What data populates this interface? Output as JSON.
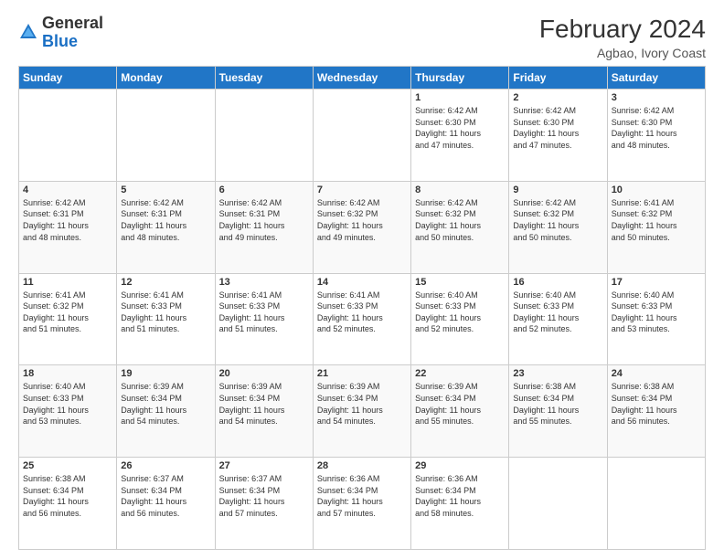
{
  "header": {
    "logo_general": "General",
    "logo_blue": "Blue",
    "month_year": "February 2024",
    "location": "Agbao, Ivory Coast"
  },
  "weekdays": [
    "Sunday",
    "Monday",
    "Tuesday",
    "Wednesday",
    "Thursday",
    "Friday",
    "Saturday"
  ],
  "weeks": [
    [
      {
        "day": "",
        "info": ""
      },
      {
        "day": "",
        "info": ""
      },
      {
        "day": "",
        "info": ""
      },
      {
        "day": "",
        "info": ""
      },
      {
        "day": "1",
        "info": "Sunrise: 6:42 AM\nSunset: 6:30 PM\nDaylight: 11 hours\nand 47 minutes."
      },
      {
        "day": "2",
        "info": "Sunrise: 6:42 AM\nSunset: 6:30 PM\nDaylight: 11 hours\nand 47 minutes."
      },
      {
        "day": "3",
        "info": "Sunrise: 6:42 AM\nSunset: 6:30 PM\nDaylight: 11 hours\nand 48 minutes."
      }
    ],
    [
      {
        "day": "4",
        "info": "Sunrise: 6:42 AM\nSunset: 6:31 PM\nDaylight: 11 hours\nand 48 minutes."
      },
      {
        "day": "5",
        "info": "Sunrise: 6:42 AM\nSunset: 6:31 PM\nDaylight: 11 hours\nand 48 minutes."
      },
      {
        "day": "6",
        "info": "Sunrise: 6:42 AM\nSunset: 6:31 PM\nDaylight: 11 hours\nand 49 minutes."
      },
      {
        "day": "7",
        "info": "Sunrise: 6:42 AM\nSunset: 6:32 PM\nDaylight: 11 hours\nand 49 minutes."
      },
      {
        "day": "8",
        "info": "Sunrise: 6:42 AM\nSunset: 6:32 PM\nDaylight: 11 hours\nand 50 minutes."
      },
      {
        "day": "9",
        "info": "Sunrise: 6:42 AM\nSunset: 6:32 PM\nDaylight: 11 hours\nand 50 minutes."
      },
      {
        "day": "10",
        "info": "Sunrise: 6:41 AM\nSunset: 6:32 PM\nDaylight: 11 hours\nand 50 minutes."
      }
    ],
    [
      {
        "day": "11",
        "info": "Sunrise: 6:41 AM\nSunset: 6:32 PM\nDaylight: 11 hours\nand 51 minutes."
      },
      {
        "day": "12",
        "info": "Sunrise: 6:41 AM\nSunset: 6:33 PM\nDaylight: 11 hours\nand 51 minutes."
      },
      {
        "day": "13",
        "info": "Sunrise: 6:41 AM\nSunset: 6:33 PM\nDaylight: 11 hours\nand 51 minutes."
      },
      {
        "day": "14",
        "info": "Sunrise: 6:41 AM\nSunset: 6:33 PM\nDaylight: 11 hours\nand 52 minutes."
      },
      {
        "day": "15",
        "info": "Sunrise: 6:40 AM\nSunset: 6:33 PM\nDaylight: 11 hours\nand 52 minutes."
      },
      {
        "day": "16",
        "info": "Sunrise: 6:40 AM\nSunset: 6:33 PM\nDaylight: 11 hours\nand 52 minutes."
      },
      {
        "day": "17",
        "info": "Sunrise: 6:40 AM\nSunset: 6:33 PM\nDaylight: 11 hours\nand 53 minutes."
      }
    ],
    [
      {
        "day": "18",
        "info": "Sunrise: 6:40 AM\nSunset: 6:33 PM\nDaylight: 11 hours\nand 53 minutes."
      },
      {
        "day": "19",
        "info": "Sunrise: 6:39 AM\nSunset: 6:34 PM\nDaylight: 11 hours\nand 54 minutes."
      },
      {
        "day": "20",
        "info": "Sunrise: 6:39 AM\nSunset: 6:34 PM\nDaylight: 11 hours\nand 54 minutes."
      },
      {
        "day": "21",
        "info": "Sunrise: 6:39 AM\nSunset: 6:34 PM\nDaylight: 11 hours\nand 54 minutes."
      },
      {
        "day": "22",
        "info": "Sunrise: 6:39 AM\nSunset: 6:34 PM\nDaylight: 11 hours\nand 55 minutes."
      },
      {
        "day": "23",
        "info": "Sunrise: 6:38 AM\nSunset: 6:34 PM\nDaylight: 11 hours\nand 55 minutes."
      },
      {
        "day": "24",
        "info": "Sunrise: 6:38 AM\nSunset: 6:34 PM\nDaylight: 11 hours\nand 56 minutes."
      }
    ],
    [
      {
        "day": "25",
        "info": "Sunrise: 6:38 AM\nSunset: 6:34 PM\nDaylight: 11 hours\nand 56 minutes."
      },
      {
        "day": "26",
        "info": "Sunrise: 6:37 AM\nSunset: 6:34 PM\nDaylight: 11 hours\nand 56 minutes."
      },
      {
        "day": "27",
        "info": "Sunrise: 6:37 AM\nSunset: 6:34 PM\nDaylight: 11 hours\nand 57 minutes."
      },
      {
        "day": "28",
        "info": "Sunrise: 6:36 AM\nSunset: 6:34 PM\nDaylight: 11 hours\nand 57 minutes."
      },
      {
        "day": "29",
        "info": "Sunrise: 6:36 AM\nSunset: 6:34 PM\nDaylight: 11 hours\nand 58 minutes."
      },
      {
        "day": "",
        "info": ""
      },
      {
        "day": "",
        "info": ""
      }
    ]
  ]
}
